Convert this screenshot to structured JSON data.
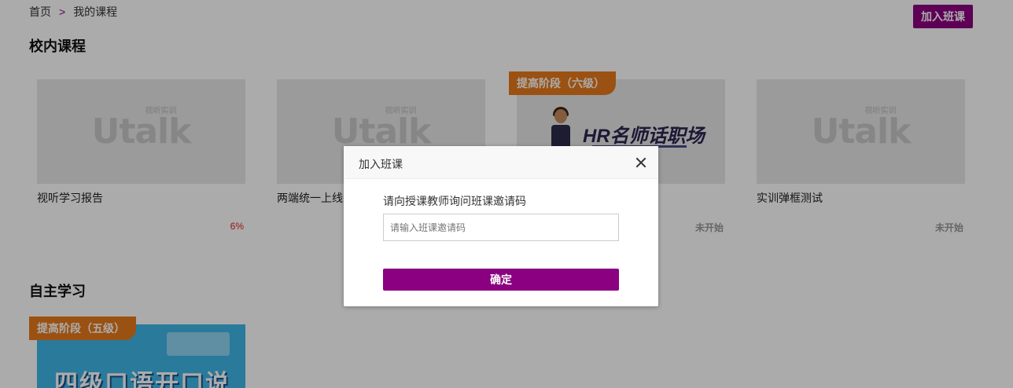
{
  "breadcrumb": {
    "home": "首页",
    "separator": ">",
    "current": "我的课程"
  },
  "header": {
    "join_button": "加入班课"
  },
  "sections": {
    "school": {
      "title": "校内课程"
    },
    "self": {
      "title": "自主学习"
    }
  },
  "school_courses": [
    {
      "name": "视听学习报告",
      "status": "6%",
      "logo": "Utalk",
      "logo_sub": "视听实训"
    },
    {
      "name": "两端统一上线测",
      "status": "",
      "logo": "Utalk",
      "logo_sub": "视听实训"
    },
    {
      "name": "",
      "tag": "提高阶段（六级）",
      "status": "未开始",
      "cover_title": "HR名师话职场"
    },
    {
      "name": "实训弹框测试",
      "status": "未开始",
      "logo": "Utalk",
      "logo_sub": "视听实训"
    }
  ],
  "self_courses": [
    {
      "tag": "提高阶段（五级）",
      "cover_title": "四级口语开口说"
    }
  ],
  "modal": {
    "title": "加入班课",
    "prompt": "请向授课教师询问班课邀请码",
    "input_placeholder": "请输入班课邀请码",
    "input_value": "",
    "confirm": "确定"
  },
  "colors": {
    "brand": "#8b0080",
    "tag": "#e8791a",
    "progress": "#e02020"
  }
}
